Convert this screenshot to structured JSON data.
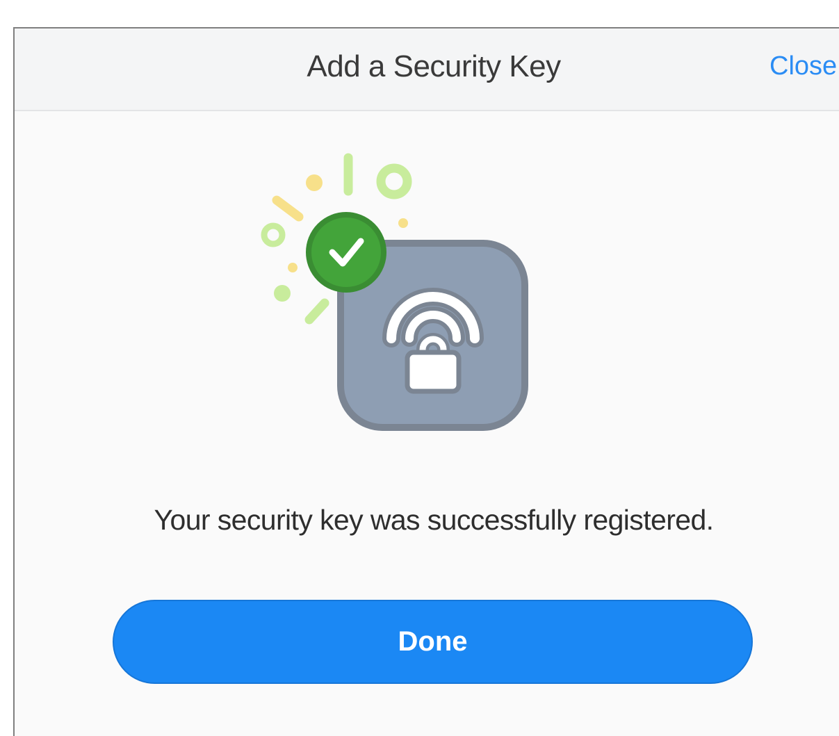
{
  "dialog": {
    "title": "Add a Security Key",
    "close_label": "Close"
  },
  "illustration": {
    "key_icon": "security-key-lock-icon",
    "badge_icon": "checkmark-icon",
    "colors": {
      "key_fill": "#8e9eb3",
      "key_outline": "#7b8593",
      "badge_fill": "#43a43a",
      "badge_outline": "#3a8d33",
      "confetti_yellow": "#f7e08a",
      "confetti_green": "#c8ec9c"
    }
  },
  "message": "Your security key was successfully registered.",
  "done_label": "Done",
  "colors": {
    "accent": "#1b88f4",
    "link": "#2a8cf4",
    "header_bg": "#f4f5f6"
  }
}
